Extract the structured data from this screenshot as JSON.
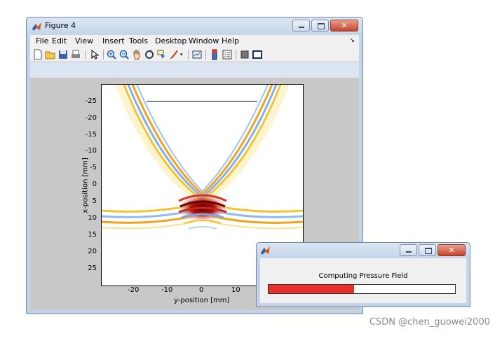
{
  "figure_window": {
    "title": "Figure 4",
    "menu": [
      "File",
      "Edit",
      "View",
      "Insert",
      "Tools",
      "Desktop",
      "Window",
      "Help"
    ],
    "toolbar_icons": [
      "new-figure-icon",
      "open-file-icon",
      "save-icon",
      "print-icon",
      "select-arrow-icon",
      "zoom-in-icon",
      "zoom-out-icon",
      "pan-hand-icon",
      "rotate-3d-icon",
      "data-cursor-icon",
      "brush-icon",
      "brush-dropdown-icon",
      "link-plot-icon",
      "colorbar-icon",
      "legend-icon",
      "hide-plot-tools-icon",
      "show-plot-tools-icon"
    ]
  },
  "plot": {
    "xlabel": "y-position [mm]",
    "ylabel": "x-position [mm]",
    "xticks": [
      "-20",
      "-10",
      "0",
      "10"
    ],
    "yticks": [
      "-25",
      "-20",
      "-15",
      "-10",
      "-5",
      "0",
      "5",
      "10",
      "15",
      "20",
      "25"
    ],
    "image_description_colormap": "blue-white-red pressure field"
  },
  "progress_dialog": {
    "message": "Computing Pressure Field",
    "progress": 0.46,
    "fill_color": "#e8312a"
  },
  "watermark": "CSDN @chen_guowei2000"
}
